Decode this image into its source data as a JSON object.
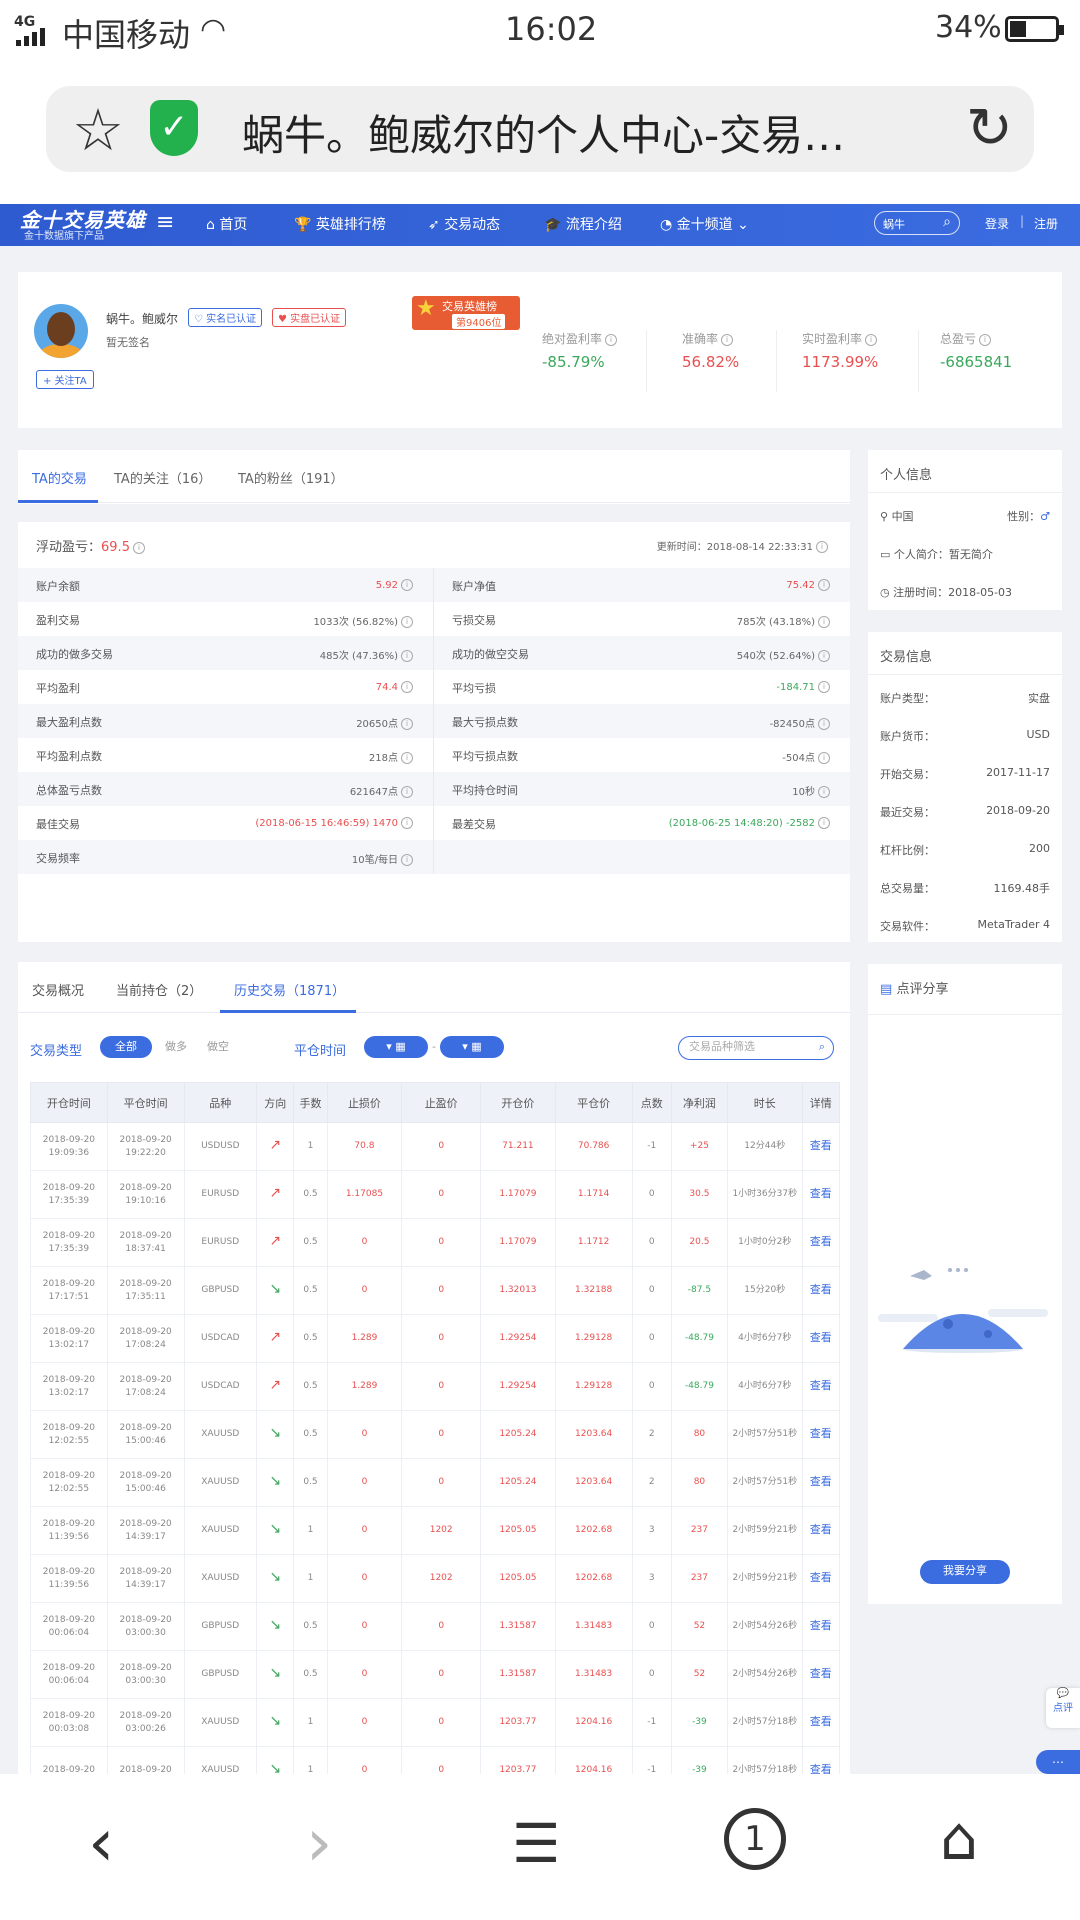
{
  "status": {
    "network": "4G",
    "carrier": "中国移动",
    "time": "16:02",
    "battery": "34%"
  },
  "browser": {
    "title": "蜗牛。鲍威尔的个人中心-交易…"
  },
  "nav": {
    "logo": "金十交易英雄",
    "logo_sub": "金十数据旗下产品",
    "items": [
      "首页",
      "英雄排行榜",
      "交易动态",
      "流程介绍",
      "金十频道"
    ],
    "search_placeholder": "蜗牛",
    "login": "登录",
    "sep": "|",
    "register": "注册"
  },
  "profile": {
    "name": "蜗牛。鲍威尔",
    "badge_real": "实名已认证",
    "badge_live": "实盘已认证",
    "signature": "暂无签名",
    "follow": "+ 关注TA",
    "hero_label": "交易英雄榜",
    "hero_rank": "第9406位",
    "stats": [
      {
        "label": "绝对盈利率",
        "value": "-85.79%",
        "color": "#3aa85a"
      },
      {
        "label": "准确率",
        "value": "56.82%",
        "color": "#e85050"
      },
      {
        "label": "实时盈利率",
        "value": "1173.99%",
        "color": "#e85050"
      },
      {
        "label": "总盈亏",
        "value": "-6865841",
        "color": "#3aa85a"
      }
    ]
  },
  "tabs1": [
    "TA的交易",
    "TA的关注（16）",
    "TA的粉丝（191）"
  ],
  "floating": {
    "label": "浮动盈亏：",
    "value": "69.5",
    "updated": "更新时间：2018-08-14 22:33:31"
  },
  "stats_rows": [
    {
      "l_label": "账户余额",
      "l_value": "5.92",
      "l_color": "#e85050",
      "r_label": "账户净值",
      "r_value": "75.42",
      "r_color": "#e85050"
    },
    {
      "l_label": "盈利交易",
      "l_value": "1033次 (56.82%)",
      "l_color": "#666",
      "r_label": "亏损交易",
      "r_value": "785次 (43.18%)",
      "r_color": "#666"
    },
    {
      "l_label": "成功的做多交易",
      "l_value": "485次 (47.36%)",
      "l_color": "#666",
      "r_label": "成功的做空交易",
      "r_value": "540次 (52.64%)",
      "r_color": "#666"
    },
    {
      "l_label": "平均盈利",
      "l_value": "74.4",
      "l_color": "#e85050",
      "r_label": "平均亏损",
      "r_value": "-184.71",
      "r_color": "#3aa85a"
    },
    {
      "l_label": "最大盈利点数",
      "l_value": "20650点",
      "l_color": "#666",
      "r_label": "最大亏损点数",
      "r_value": "-82450点",
      "r_color": "#666"
    },
    {
      "l_label": "平均盈利点数",
      "l_value": "218点",
      "l_color": "#666",
      "r_label": "平均亏损点数",
      "r_value": "-504点",
      "r_color": "#666"
    },
    {
      "l_label": "总体盈亏点数",
      "l_value": "621647点",
      "l_color": "#666",
      "r_label": "平均持仓时间",
      "r_value": "10秒",
      "r_color": "#666"
    },
    {
      "l_label": "最佳交易",
      "l_value": "(2018-06-15 16:46:59) 1470",
      "l_color": "#e85050",
      "r_label": "最差交易",
      "r_value": "(2018-06-25 14:48:20) -2582",
      "r_color": "#3aa85a"
    },
    {
      "l_label": "交易频率",
      "l_value": "10笔/每日",
      "l_color": "#666",
      "r_label": "",
      "r_value": "",
      "r_color": "#666"
    }
  ],
  "personal": {
    "title": "个人信息",
    "country": "中国",
    "gender_label": "性别：",
    "intro": "个人简介：暂无简介",
    "register": "注册时间：2018-05-03"
  },
  "trade_info": {
    "title": "交易信息",
    "rows": [
      {
        "label": "账户类型：",
        "value": "实盘"
      },
      {
        "label": "账户货币：",
        "value": "USD"
      },
      {
        "label": "开始交易：",
        "value": "2017-11-17"
      },
      {
        "label": "最近交易：",
        "value": "2018-09-20"
      },
      {
        "label": "杠杆比例：",
        "value": "200"
      },
      {
        "label": "总交易量：",
        "value": "1169.48手"
      },
      {
        "label": "交易软件：",
        "value": "MetaTrader 4"
      }
    ]
  },
  "comment": {
    "title": "点评分享",
    "button": "我要分享"
  },
  "hist_tabs": [
    "交易概况",
    "当前持仓（2）",
    "历史交易（1871）"
  ],
  "filters": {
    "type_label": "交易类型",
    "all": "全部",
    "long": "做多",
    "short": "做空",
    "close_time": "平仓时间",
    "search_placeholder": "交易品种筛选"
  },
  "table_headers": [
    "开仓时间",
    "平仓时间",
    "品种",
    "方向",
    "手数",
    "止损价",
    "止盈价",
    "开仓价",
    "平仓价",
    "点数",
    "净利润",
    "时长",
    "详情"
  ],
  "trades": [
    {
      "open": "2018-09-20 19:09:36",
      "close": "2018-09-20 19:22:20",
      "sym": "USDUSD",
      "dir": "up",
      "lots": "1",
      "sl": "70.8",
      "tp": "0",
      "op": "71.211",
      "cp": "70.786",
      "pts": "-1",
      "profit": "+25",
      "dur": "12分44秒",
      "detail": "查看"
    },
    {
      "open": "2018-09-20 17:35:39",
      "close": "2018-09-20 19:10:16",
      "sym": "EURUSD",
      "dir": "up",
      "lots": "0.5",
      "sl": "1.17085",
      "tp": "0",
      "op": "1.17079",
      "cp": "1.1714",
      "pts": "0",
      "profit": "30.5",
      "dur": "1小时36分37秒",
      "detail": "查看"
    },
    {
      "open": "2018-09-20 17:35:39",
      "close": "2018-09-20 18:37:41",
      "sym": "EURUSD",
      "dir": "up",
      "lots": "0.5",
      "sl": "0",
      "tp": "0",
      "op": "1.17079",
      "cp": "1.1712",
      "pts": "0",
      "profit": "20.5",
      "dur": "1小时0分2秒",
      "detail": "查看"
    },
    {
      "open": "2018-09-20 17:17:51",
      "close": "2018-09-20 17:35:11",
      "sym": "GBPUSD",
      "dir": "down",
      "lots": "0.5",
      "sl": "0",
      "tp": "0",
      "op": "1.32013",
      "cp": "1.32188",
      "pts": "0",
      "profit": "-87.5",
      "dur": "15分20秒",
      "detail": "查看"
    },
    {
      "open": "2018-09-20 13:02:17",
      "close": "2018-09-20 17:08:24",
      "sym": "USDCAD",
      "dir": "up",
      "lots": "0.5",
      "sl": "1.289",
      "tp": "0",
      "op": "1.29254",
      "cp": "1.29128",
      "pts": "0",
      "profit": "-48.79",
      "dur": "4小时6分7秒",
      "detail": "查看"
    },
    {
      "open": "2018-09-20 13:02:17",
      "close": "2018-09-20 17:08:24",
      "sym": "USDCAD",
      "dir": "up",
      "lots": "0.5",
      "sl": "1.289",
      "tp": "0",
      "op": "1.29254",
      "cp": "1.29128",
      "pts": "0",
      "profit": "-48.79",
      "dur": "4小时6分7秒",
      "detail": "查看"
    },
    {
      "open": "2018-09-20 12:02:55",
      "close": "2018-09-20 15:00:46",
      "sym": "XAUUSD",
      "dir": "down",
      "lots": "0.5",
      "sl": "0",
      "tp": "0",
      "op": "1205.24",
      "cp": "1203.64",
      "pts": "2",
      "profit": "80",
      "dur": "2小时57分51秒",
      "detail": "查看"
    },
    {
      "open": "2018-09-20 12:02:55",
      "close": "2018-09-20 15:00:46",
      "sym": "XAUUSD",
      "dir": "down",
      "lots": "0.5",
      "sl": "0",
      "tp": "0",
      "op": "1205.24",
      "cp": "1203.64",
      "pts": "2",
      "profit": "80",
      "dur": "2小时57分51秒",
      "detail": "查看"
    },
    {
      "open": "2018-09-20 11:39:56",
      "close": "2018-09-20 14:39:17",
      "sym": "XAUUSD",
      "dir": "down",
      "lots": "1",
      "sl": "0",
      "tp": "1202",
      "op": "1205.05",
      "cp": "1202.68",
      "pts": "3",
      "profit": "237",
      "dur": "2小时59分21秒",
      "detail": "查看"
    },
    {
      "open": "2018-09-20 11:39:56",
      "close": "2018-09-20 14:39:17",
      "sym": "XAUUSD",
      "dir": "down",
      "lots": "1",
      "sl": "0",
      "tp": "1202",
      "op": "1205.05",
      "cp": "1202.68",
      "pts": "3",
      "profit": "237",
      "dur": "2小时59分21秒",
      "detail": "查看"
    },
    {
      "open": "2018-09-20 00:06:04",
      "close": "2018-09-20 03:00:30",
      "sym": "GBPUSD",
      "dir": "down",
      "lots": "0.5",
      "sl": "0",
      "tp": "0",
      "op": "1.31587",
      "cp": "1.31483",
      "pts": "0",
      "profit": "52",
      "dur": "2小时54分26秒",
      "detail": "查看"
    },
    {
      "open": "2018-09-20 00:06:04",
      "close": "2018-09-20 03:00:30",
      "sym": "GBPUSD",
      "dir": "down",
      "lots": "0.5",
      "sl": "0",
      "tp": "0",
      "op": "1.31587",
      "cp": "1.31483",
      "pts": "0",
      "profit": "52",
      "dur": "2小时54分26秒",
      "detail": "查看"
    },
    {
      "open": "2018-09-20 00:03:08",
      "close": "2018-09-20 03:00:26",
      "sym": "XAUUSD",
      "dir": "down",
      "lots": "1",
      "sl": "0",
      "tp": "0",
      "op": "1203.77",
      "cp": "1204.16",
      "pts": "-1",
      "profit": "-39",
      "dur": "2小时57分18秒",
      "detail": "查看"
    },
    {
      "open": "2018-09-20",
      "close": "2018-09-20",
      "sym": "XAUUSD",
      "dir": "down",
      "lots": "1",
      "sl": "0",
      "tp": "0",
      "op": "1203.77",
      "cp": "1204.16",
      "pts": "-1",
      "profit": "-39",
      "dur": "2小时57分18秒",
      "detail": "查看"
    }
  ],
  "float_widget": {
    "label": "点评"
  }
}
